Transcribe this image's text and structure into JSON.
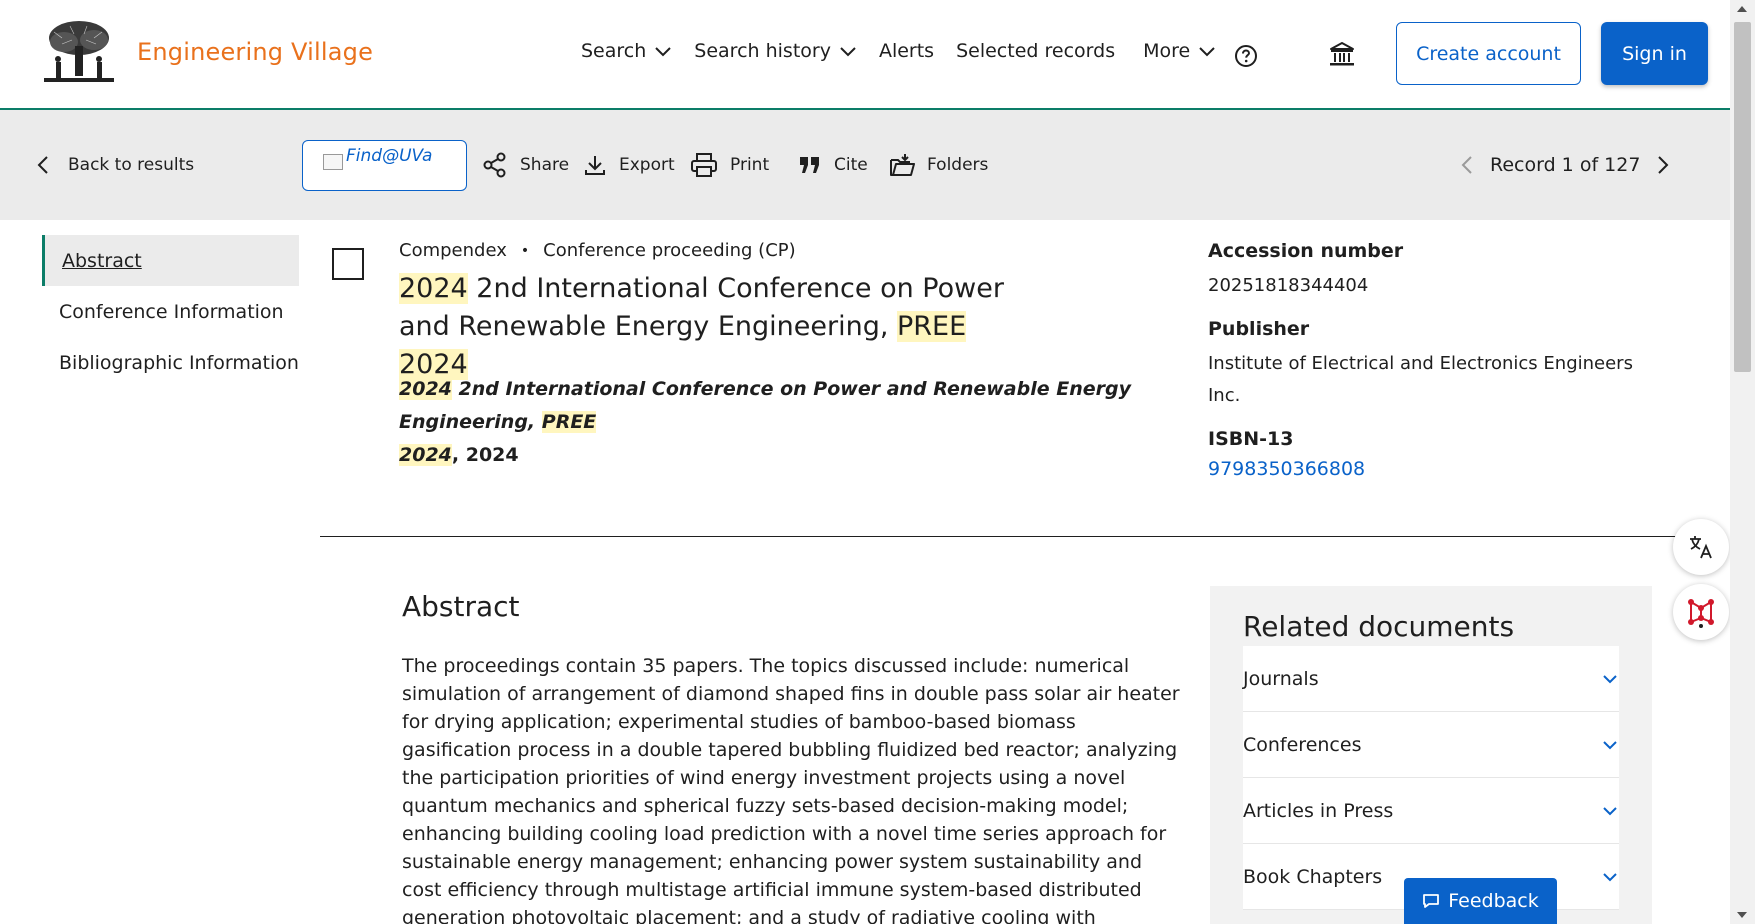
{
  "header": {
    "brand": "Engineering Village",
    "nav": [
      {
        "label": "Search",
        "has_dropdown": true
      },
      {
        "label": "Search history",
        "has_dropdown": true
      },
      {
        "label": "Alerts",
        "has_dropdown": false
      },
      {
        "label": "Selected records",
        "has_dropdown": false
      },
      {
        "label": "More",
        "has_dropdown": true
      }
    ],
    "create_account": "Create account",
    "sign_in": "Sign in"
  },
  "toolbar": {
    "back": "Back to results",
    "find": "Find@UVa",
    "share": "Share",
    "export": "Export",
    "print": "Print",
    "cite": "Cite",
    "folders": "Folders",
    "record_label": "Record 1 of 127"
  },
  "sidenav": {
    "items": [
      "Abstract",
      "Conference Information",
      "Bibliographic Information"
    ]
  },
  "record": {
    "database": "Compendex",
    "doc_type": "Conference proceeding (CP)",
    "title_year": "2024",
    "title_middle_1": " 2nd International Conference on Power",
    "title_middle_2": "and Renewable Energy Engineering, ",
    "title_pree": "PREE",
    "title_year_2": "2024",
    "source_year": "2024",
    "source_text": " 2nd International Conference on Power and Renewable Energy Engineering, ",
    "source_pree": "PREE",
    "source_year_2": "2024",
    "source_tail": ", 2024"
  },
  "details": {
    "accession_label": "Accession number",
    "accession_value": "20251818344404",
    "publisher_label": "Publisher",
    "publisher_value": "Institute of Electrical and Electronics Engineers Inc.",
    "isbn_label": "ISBN-13",
    "isbn_value": "9798350366808"
  },
  "abstract": {
    "heading": "Abstract",
    "text": "The proceedings contain 35 papers. The topics discussed include: numerical simulation of arrangement of diamond shaped fins in double pass solar air heater for drying application; experimental studies of bamboo-based biomass gasification process in a double tapered bubbling fluidized bed reactor; analyzing the participation priorities of wind energy investment projects using a novel quantum mechanics and spherical fuzzy sets-based decision-making model; enhancing building cooling load prediction with a novel time series approach for sustainable energy management; enhancing power system sustainability and cost efficiency through multistage artificial immune system-based distributed generation photovoltaic placement; and a study of radiative cooling with thermoelectric for"
  },
  "related": {
    "heading": "Related documents",
    "items": [
      "Journals",
      "Conferences",
      "Articles in Press",
      "Book Chapters"
    ]
  },
  "feedback": "Feedback",
  "colors": {
    "brand_orange": "#e9711c",
    "primary_blue": "#0a62c9",
    "accent_green": "#0c7d68",
    "highlight": "#fff6bf"
  },
  "icons": [
    "chevron-down-icon",
    "help-icon",
    "institution-icon",
    "chevron-left-icon",
    "share-icon",
    "download-icon",
    "print-icon",
    "quote-icon",
    "folder-icon",
    "chevron-right-icon",
    "translate-icon",
    "network-icon",
    "chat-icon"
  ]
}
